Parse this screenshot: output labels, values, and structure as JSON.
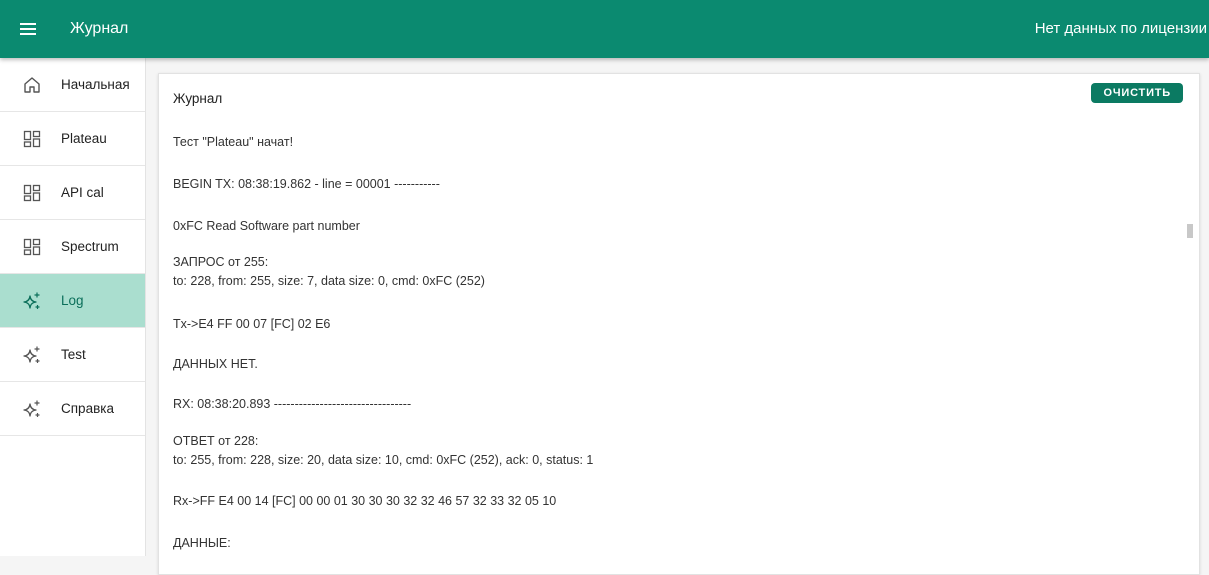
{
  "header": {
    "title": "Журнал",
    "license_status": "Нет данных по лицензии",
    "bg_color": "#0b8a70"
  },
  "sidebar": {
    "items": [
      {
        "label": "Начальная",
        "icon": "home-icon",
        "active": false
      },
      {
        "label": "Plateau",
        "icon": "dashboard-icon",
        "active": false
      },
      {
        "label": "API cal",
        "icon": "dashboard-icon",
        "active": false
      },
      {
        "label": "Spectrum",
        "icon": "dashboard-icon",
        "active": false
      },
      {
        "label": "Log",
        "icon": "sparkle-icon",
        "active": true
      },
      {
        "label": "Test",
        "icon": "sparkle-icon",
        "active": false
      },
      {
        "label": "Справка",
        "icon": "sparkle-icon",
        "active": false
      }
    ],
    "active_color": "#aadecf"
  },
  "panel": {
    "title": "Журнал",
    "clear_label": "ОЧИСТИТЬ"
  },
  "log": {
    "entries": [
      "Тест \"Plateau\" начат!",
      "BEGIN TX: 08:38:19.862 - line = 00001 -----------",
      "0xFC Read Software part number",
      "ЗАПРОС от 255:",
      "to: 228, from: 255, size: 7, data size: 0, cmd: 0xFC (252)",
      "Tx->E4 FF 00 07 [FC] 02 E6",
      "ДАННЫХ НЕТ.",
      "RX: 08:38:20.893 ---------------------------------",
      "ОТВЕТ от 228:",
      "to: 255, from: 228, size: 20, data size: 10, cmd: 0xFC (252), ack: 0, status: 1",
      "Rx->FF E4 00 14 [FC] 00 00 01 30 30 30 32 32 46 57 32 33 32 05 10",
      "ДАННЫЕ:"
    ]
  }
}
